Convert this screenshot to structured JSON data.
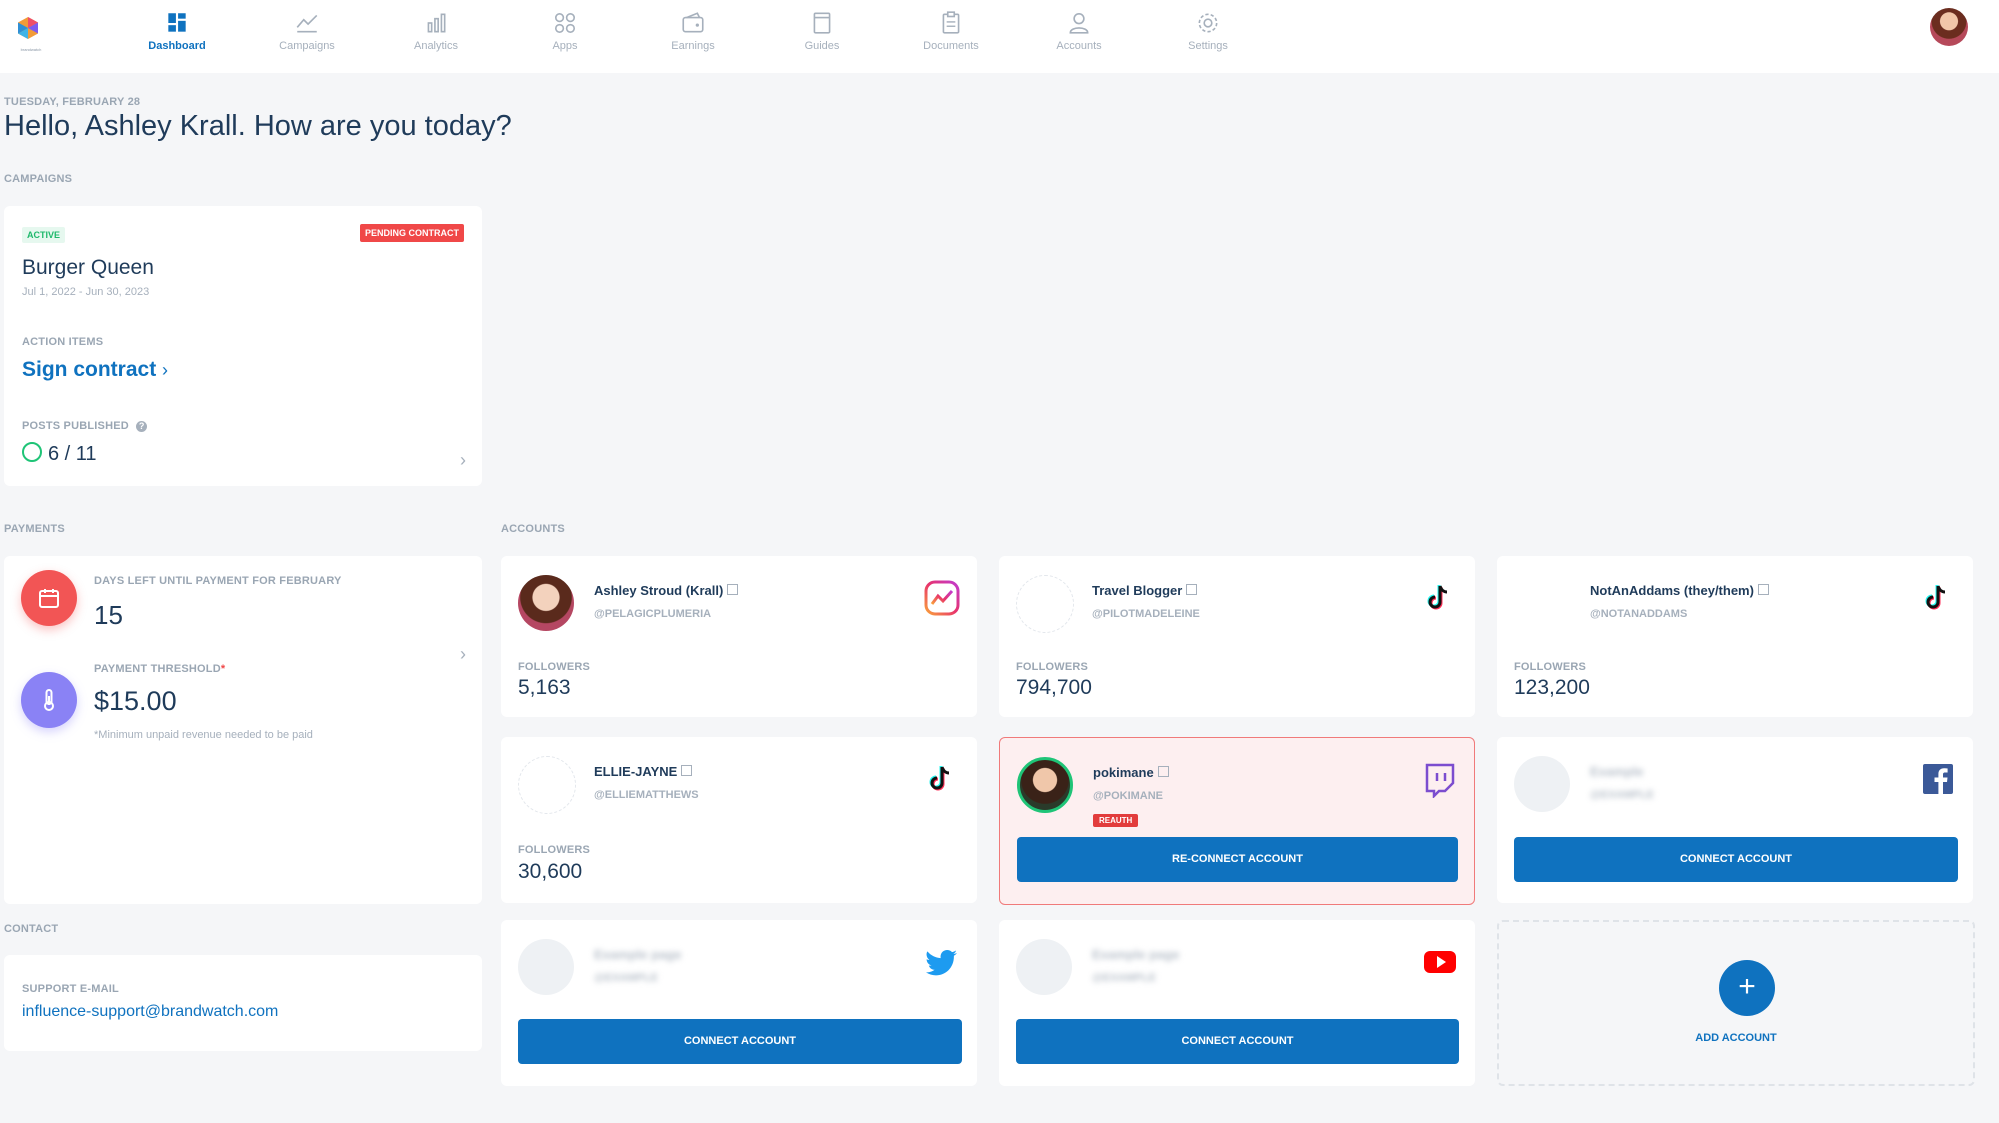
{
  "app": {
    "logo_text": "brandwatch"
  },
  "nav": {
    "items": [
      {
        "label": "Dashboard",
        "icon": "dashboard-icon"
      },
      {
        "label": "Campaigns",
        "icon": "campaigns-icon"
      },
      {
        "label": "Analytics",
        "icon": "analytics-icon"
      },
      {
        "label": "Apps",
        "icon": "apps-icon"
      },
      {
        "label": "Earnings",
        "icon": "wallet-icon"
      },
      {
        "label": "Guides",
        "icon": "book-icon"
      },
      {
        "label": "Documents",
        "icon": "clipboard-icon"
      },
      {
        "label": "Accounts",
        "icon": "user-icon"
      },
      {
        "label": "Settings",
        "icon": "gear-icon"
      }
    ],
    "active": "Dashboard"
  },
  "header": {
    "date": "TUESDAY, FEBRUARY 28",
    "greeting": "Hello, Ashley Krall. How are you today?"
  },
  "sections": {
    "campaigns": "CAMPAIGNS",
    "payments": "PAYMENTS",
    "accounts": "ACCOUNTS",
    "contact": "CONTACT"
  },
  "campaign": {
    "status": "ACTIVE",
    "contract_badge": "PENDING CONTRACT",
    "title": "Burger Queen",
    "dates": "Jul 1, 2022 - Jun 30, 2023",
    "action_label": "ACTION ITEMS",
    "action": "Sign contract",
    "posts_label": "POSTS PUBLISHED",
    "posts": "6 / 11"
  },
  "payments": {
    "days_label": "DAYS LEFT UNTIL PAYMENT FOR FEBRUARY",
    "days_value": "15",
    "threshold_label": "PAYMENT THRESHOLD",
    "threshold_value": "$15.00",
    "threshold_note": "*Minimum unpaid revenue needed to be paid"
  },
  "contact": {
    "label": "SUPPORT E-MAIL",
    "email": "influence-support@brandwatch.com"
  },
  "accounts": [
    {
      "name": "Ashley Stroud (Krall)",
      "handle": "@PELAGICPLUMERIA",
      "followers_label": "FOLLOWERS",
      "followers": "5,163",
      "platform": "instagram-icon"
    },
    {
      "name": "Travel Blogger",
      "handle": "@PILOTMADELEINE",
      "followers_label": "FOLLOWERS",
      "followers": "794,700",
      "platform": "tiktok-icon"
    },
    {
      "name": "NotAnAddams (they/them)",
      "handle": "@NOTANADDAMS",
      "followers_label": "FOLLOWERS",
      "followers": "123,200",
      "platform": "tiktok-icon"
    },
    {
      "name": "ELLIE-JAYNE",
      "handle": "@ELLIEMATTHEWS",
      "followers_label": "FOLLOWERS",
      "followers": "30,600",
      "platform": "tiktok-icon"
    },
    {
      "name": "pokimane",
      "handle": "@POKIMANE",
      "badge": "REAUTH",
      "button": "RE-CONNECT ACCOUNT",
      "platform": "twitch-icon"
    },
    {
      "name": "Example",
      "handle": "@EXAMPLE",
      "button": "CONNECT ACCOUNT",
      "platform": "facebook-icon"
    },
    {
      "name": "Example page",
      "handle": "@EXAMPLE",
      "button": "CONNECT ACCOUNT",
      "platform": "twitter-icon"
    },
    {
      "name": "Example page",
      "handle": "@EXAMPLE",
      "button": "CONNECT ACCOUNT",
      "platform": "youtube-icon"
    }
  ],
  "add_account": {
    "label": "ADD ACCOUNT"
  },
  "colors": {
    "primary": "#0f72bf",
    "danger": "#f04848",
    "success": "#1fc477",
    "purple": "#8a82f5",
    "background": "#f5f6f8"
  }
}
